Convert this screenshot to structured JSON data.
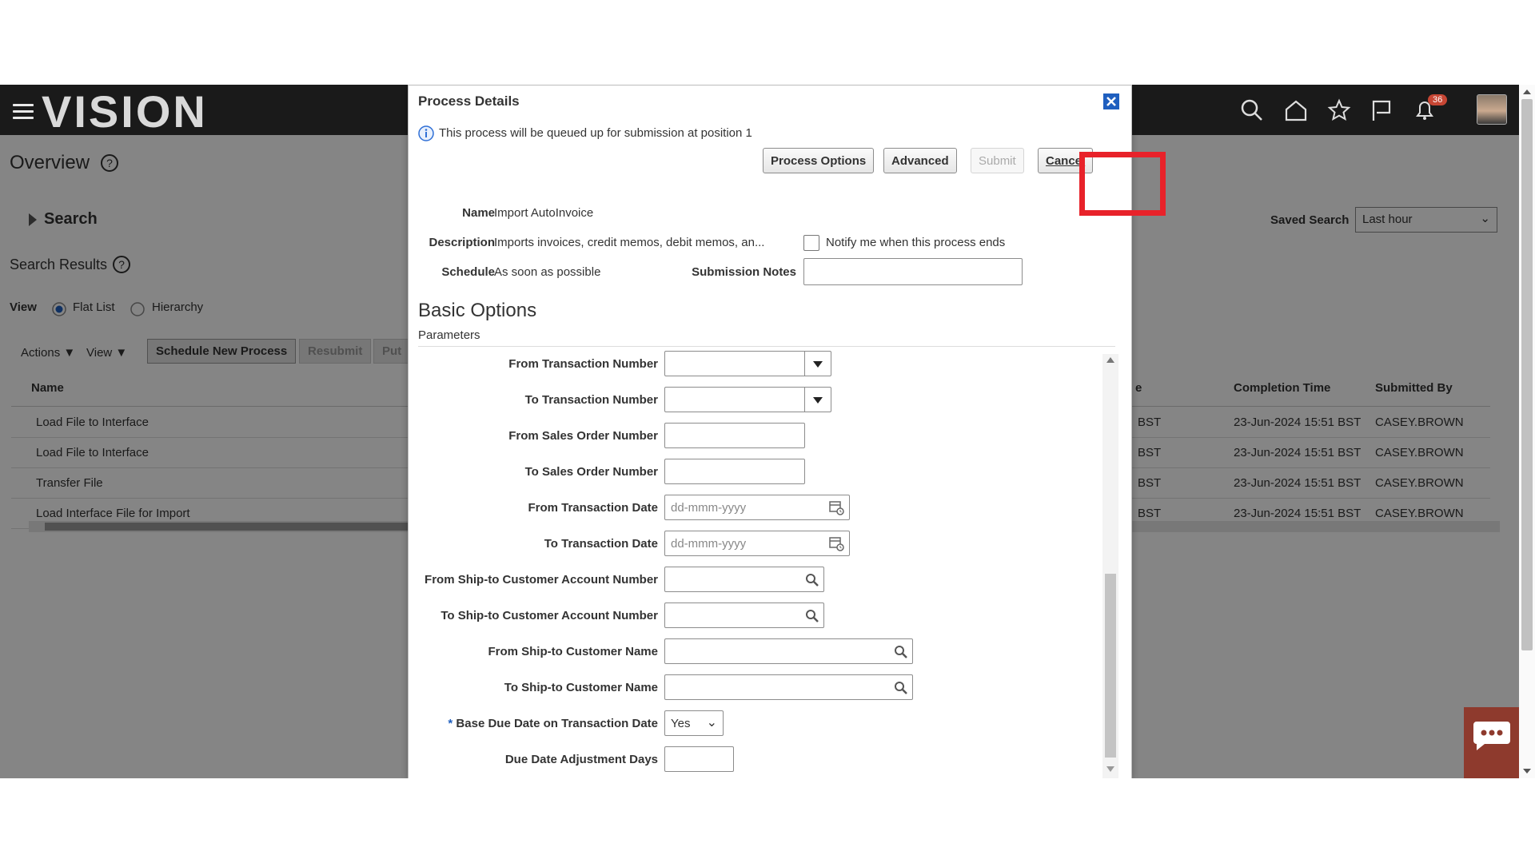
{
  "app": {
    "logo": "VISION",
    "page_title": "Overview",
    "notifications_count": "36",
    "search_section": "Search",
    "saved_search_label": "Saved Search",
    "saved_search_value": "Last hour",
    "search_results": "Search Results",
    "view_label": "View",
    "view_options": [
      "Flat List",
      "Hierarchy"
    ],
    "toolbar": {
      "actions": "Actions",
      "view": "View",
      "schedule_new": "Schedule New Process",
      "resubmit": "Resubmit",
      "put": "Put"
    },
    "table": {
      "headers": {
        "name": "Name",
        "e": "e",
        "completion_time": "Completion Time",
        "submitted_by": "Submitted By"
      },
      "rows": [
        {
          "name": "Load File to Interface",
          "tz": "BST",
          "completion": "23-Jun-2024 15:51 BST",
          "by": "CASEY.BROWN"
        },
        {
          "name": "Load File to Interface",
          "tz": "BST",
          "completion": "23-Jun-2024 15:51 BST",
          "by": "CASEY.BROWN"
        },
        {
          "name": "Transfer File",
          "tz": "BST",
          "completion": "23-Jun-2024 15:51 BST",
          "by": "CASEY.BROWN"
        },
        {
          "name": "Load Interface File for Import",
          "tz": "BST",
          "completion": "23-Jun-2024 15:51 BST",
          "by": "CASEY.BROWN"
        }
      ]
    }
  },
  "dialog": {
    "title": "Process Details",
    "info": "This process will be queued up for submission at position 1",
    "buttons": {
      "process_options": "Process Options",
      "advanced": "Advanced",
      "submit": "Submit",
      "cancel": "Cancel"
    },
    "name_label": "Name",
    "name_value": "Import AutoInvoice",
    "description_label": "Description",
    "description_value": "Imports invoices, credit memos, debit memos, an...",
    "schedule_label": "Schedule",
    "schedule_value": "As soon as possible",
    "notify_label": "Notify me when this process ends",
    "submission_notes_label": "Submission Notes",
    "basic_options": "Basic Options",
    "parameters": "Parameters",
    "params": {
      "from_txn_number": "From Transaction Number",
      "to_txn_number": "To Transaction Number",
      "from_so_number": "From Sales Order Number",
      "to_so_number": "To Sales Order Number",
      "from_txn_date": "From Transaction Date",
      "to_txn_date": "To Transaction Date",
      "date_placeholder": "dd-mmm-yyyy",
      "from_ship_acct": "From Ship-to Customer Account Number",
      "to_ship_acct": "To Ship-to Customer Account Number",
      "from_ship_name": "From Ship-to Customer Name",
      "to_ship_name": "To Ship-to Customer Name",
      "required_mark": "*",
      "base_due_date": "Base Due Date on Transaction Date",
      "base_due_date_value": "Yes",
      "due_date_adj": "Due Date Adjustment Days"
    }
  },
  "colors": {
    "highlight": "#e8222a",
    "close": "#1f5fbf",
    "info": "#2f6fd6",
    "topbar": "#1a1a1a"
  }
}
